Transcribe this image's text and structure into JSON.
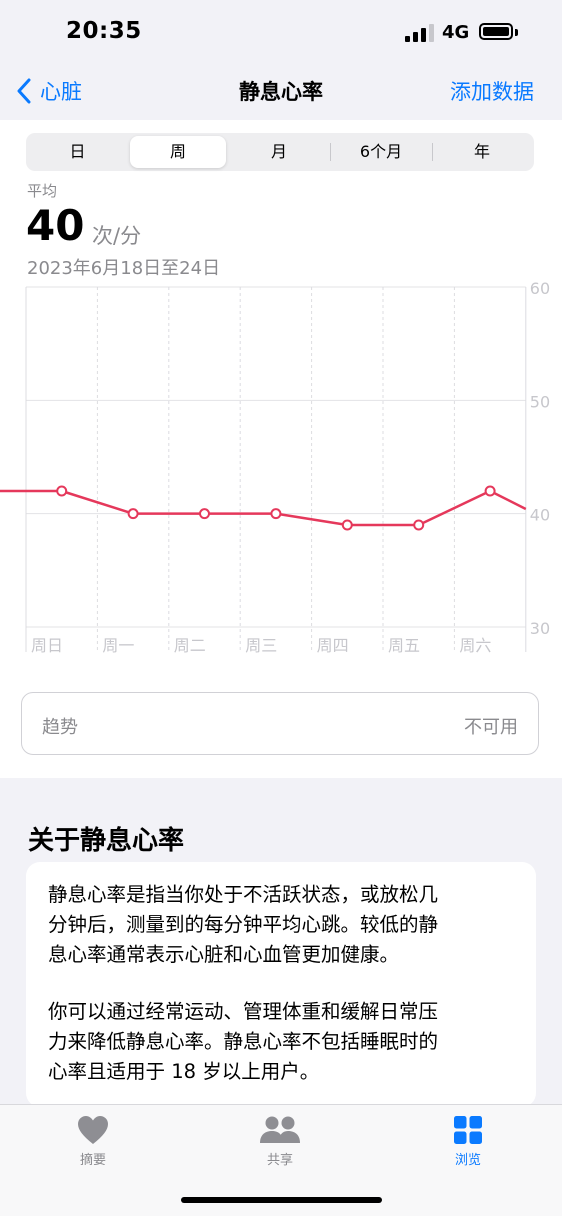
{
  "status": {
    "time": "20:35",
    "network": "4G"
  },
  "nav": {
    "back_label": "心脏",
    "title": "静息心率",
    "action_label": "添加数据"
  },
  "segments": [
    "日",
    "周",
    "月",
    "6个月",
    "年"
  ],
  "selected_segment": "周",
  "summary": {
    "avg_label": "平均",
    "avg_value": "40",
    "unit": "次/分",
    "date_range": "2023年6月18日至24日"
  },
  "chart_data": {
    "type": "line",
    "categories": [
      "周日",
      "周一",
      "周二",
      "周三",
      "周四",
      "周五",
      "周六"
    ],
    "series": [
      {
        "values": [
          42,
          40,
          40,
          40,
          39,
          39,
          42
        ]
      }
    ],
    "ylim": [
      30,
      60
    ],
    "yticks": [
      60,
      50,
      40,
      30
    ],
    "line_color": "#e5385b",
    "grid": true
  },
  "trend": {
    "label": "趋势",
    "value": "不可用"
  },
  "about": {
    "title": "关于静息心率",
    "p1_lines": [
      "静息心率是指当你处于不活跃状态，或放松几",
      "分钟后，测量到的每分钟平均心跳。较低的静",
      "息心率通常表示心脏和心血管更加健康。"
    ],
    "p2_lines": [
      "你可以通过经常运动、管理体重和缓解日常压",
      "力来降低静息心率。静息心率不包括睡眠时的",
      "心率且适用于 18 岁以上用户。"
    ]
  },
  "tabs": [
    {
      "label": "摘要",
      "icon": "heart-icon"
    },
    {
      "label": "共享",
      "icon": "people-icon"
    },
    {
      "label": "浏览",
      "icon": "grid-icon"
    }
  ],
  "active_tab": "浏览",
  "colors": {
    "accent": "#0a7aff",
    "chart_line": "#e5385b"
  }
}
